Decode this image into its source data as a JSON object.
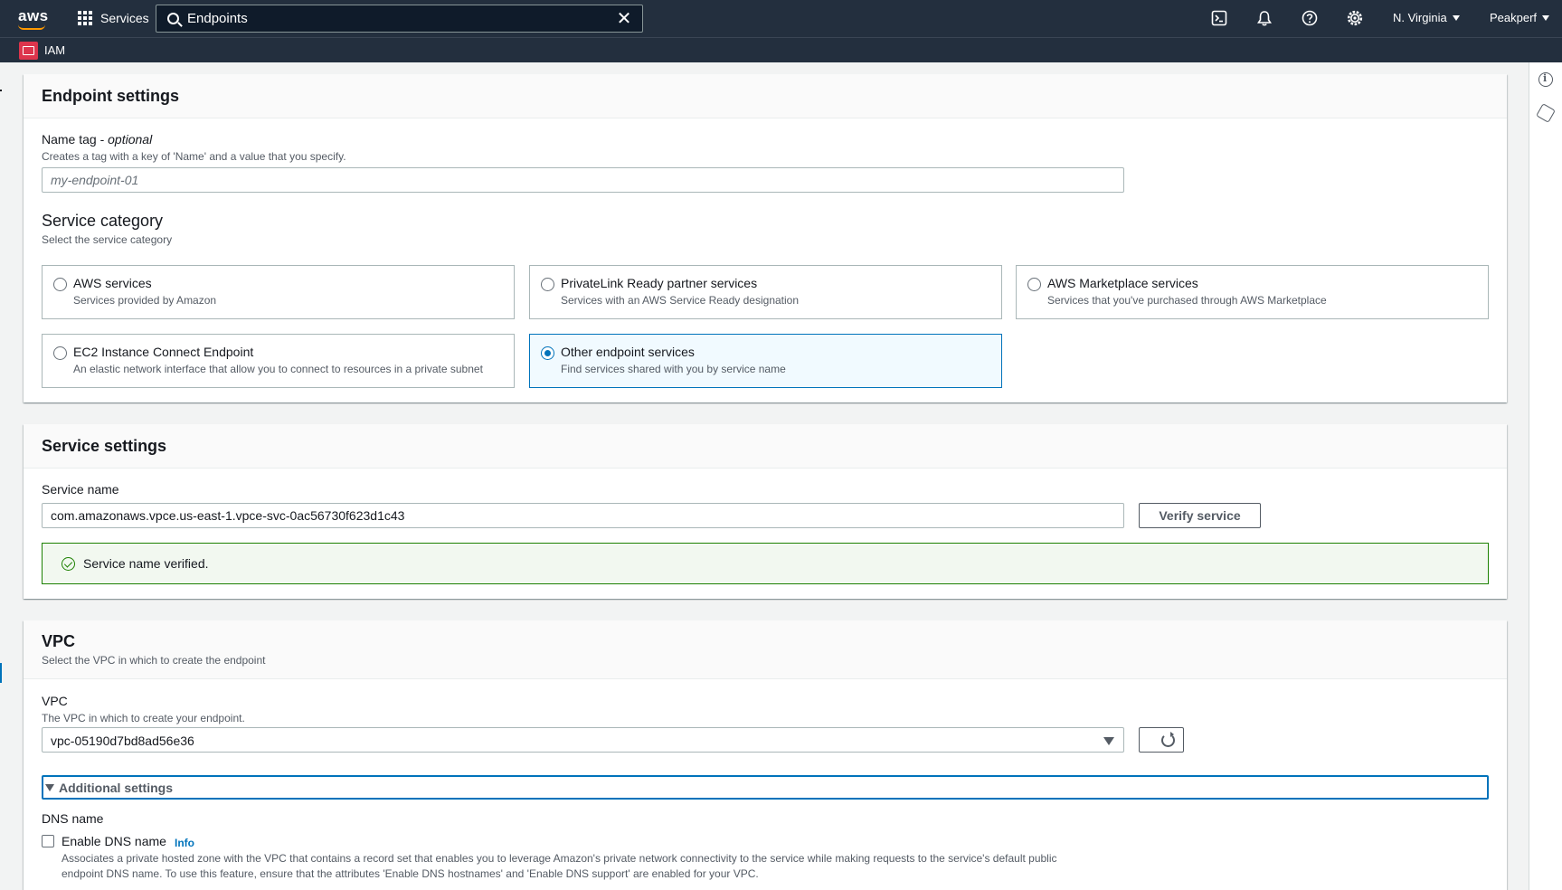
{
  "topnav": {
    "logo": "aws",
    "services_label": "Services",
    "search_value": "Endpoints",
    "region": "N. Virginia",
    "account": "Peakperf",
    "icons": [
      "cloudshell-icon",
      "notifications-icon",
      "help-icon",
      "settings-icon"
    ]
  },
  "servicebar": {
    "service_label": "IAM"
  },
  "endpoint_settings": {
    "title": "Endpoint settings",
    "name_tag_label": "Name tag -",
    "name_tag_optional": "optional",
    "name_tag_desc": "Creates a tag with a key of 'Name' and a value that you specify.",
    "name_tag_placeholder": "my-endpoint-01",
    "category_title": "Service category",
    "category_desc": "Select the service category",
    "tiles": [
      {
        "title": "AWS services",
        "desc": "Services provided by Amazon",
        "selected": false
      },
      {
        "title": "PrivateLink Ready partner services",
        "desc": "Services with an AWS Service Ready designation",
        "selected": false
      },
      {
        "title": "AWS Marketplace services",
        "desc": "Services that you've purchased through AWS Marketplace",
        "selected": false
      },
      {
        "title": "EC2 Instance Connect Endpoint",
        "desc": "An elastic network interface that allow you to connect to resources in a private subnet",
        "selected": false
      },
      {
        "title": "Other endpoint services",
        "desc": "Find services shared with you by service name",
        "selected": true
      }
    ]
  },
  "service_settings": {
    "title": "Service settings",
    "service_name_label": "Service name",
    "service_name_value": "com.amazonaws.vpce.us-east-1.vpce-svc-0ac56730f623d1c43",
    "verify_button": "Verify service",
    "verified_message": "Service name verified."
  },
  "vpc": {
    "title": "VPC",
    "desc": "Select the VPC in which to create the endpoint",
    "vpc_label": "VPC",
    "vpc_desc": "The VPC in which to create your endpoint.",
    "vpc_value": "vpc-05190d7bd8ad56e36",
    "additional_settings": "Additional settings",
    "dns_title": "DNS name",
    "enable_dns_label": "Enable DNS name",
    "info_link": "Info",
    "dns_desc_line1": "Associates a private hosted zone with the VPC that contains a record set that enables you to leverage Amazon's private network connectivity to the service while making requests to the service's default public",
    "dns_desc_line2": "endpoint DNS name. To use this feature, ensure that the attributes 'Enable DNS hostnames' and 'Enable DNS support' are enabled for your VPC."
  },
  "colors": {
    "nav_bg": "#232f3e",
    "accent": "#0073bb",
    "success": "#1d8102",
    "iam_red": "#dd344c"
  }
}
